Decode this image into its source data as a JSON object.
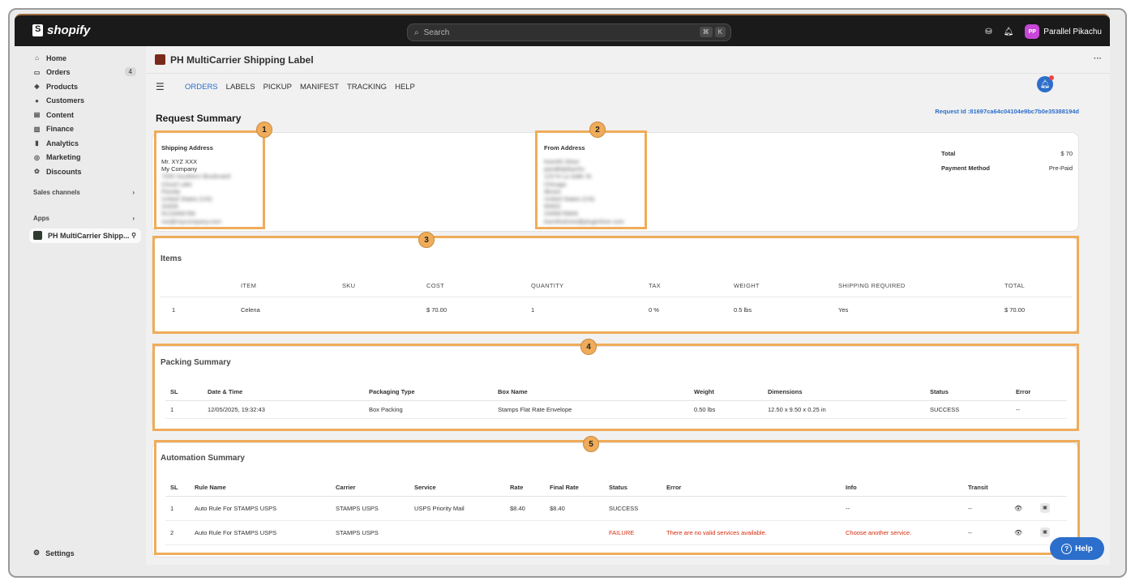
{
  "topbar": {
    "brand": "shopify",
    "search_placeholder": "Search",
    "shortcut_keys": [
      "⌘",
      "K"
    ],
    "user_initials": "PP",
    "user_name": "Parallel Pikachu"
  },
  "sidebar": {
    "items": [
      {
        "label": "Home",
        "icon": "home-icon"
      },
      {
        "label": "Orders",
        "icon": "orders-icon",
        "badge": "4"
      },
      {
        "label": "Products",
        "icon": "tag-icon"
      },
      {
        "label": "Customers",
        "icon": "person-icon"
      },
      {
        "label": "Content",
        "icon": "content-icon"
      },
      {
        "label": "Finance",
        "icon": "bank-icon"
      },
      {
        "label": "Analytics",
        "icon": "bar-chart-icon"
      },
      {
        "label": "Marketing",
        "icon": "target-icon"
      },
      {
        "label": "Discounts",
        "icon": "discount-icon"
      }
    ],
    "sales_channels": "Sales channels",
    "apps": "Apps",
    "app_item": "PH MultiCarrier Shipp...",
    "settings": "Settings"
  },
  "app": {
    "title": "PH MultiCarrier Shipping Label",
    "tabs": [
      "ORDERS",
      "LABELS",
      "PICKUP",
      "MANIFEST",
      "TRACKING",
      "HELP"
    ],
    "page_title": "Request Summary",
    "request_id": "Request Id :81697ca64c04104e9bc7b0e35388194d"
  },
  "shipping_address": {
    "title": "Shipping Address",
    "lines": [
      "Mr. XYZ XXX",
      "My Company",
      "7000 Southern Boulevard",
      "Cloud Lake",
      "Florida",
      "United States (US)",
      "33406",
      "9123456789",
      "me@mycompany.com"
    ]
  },
  "from_address": {
    "title": "From Address",
    "lines": [
      "Keerthi Shee",
      "parallelpikachu",
      "123 N La Salle St",
      "Chicago",
      "Illinois",
      "United States (US)",
      "60602",
      "2345678909",
      "keerthishree@pluginhive.com"
    ]
  },
  "summary": {
    "total_label": "Total",
    "total_value": "$ 70",
    "payment_label": "Payment Method",
    "payment_value": "Pre-Paid"
  },
  "items": {
    "title": "Items",
    "headers": [
      "",
      "ITEM",
      "SKU",
      "COST",
      "QUANTITY",
      "TAX",
      "WEIGHT",
      "SHIPPING REQUIRED",
      "TOTAL"
    ],
    "rows": [
      [
        "1",
        "Celena",
        "",
        "$ 70.00",
        "1",
        "0 %",
        "0.5 lbs",
        "Yes",
        "$ 70.00"
      ]
    ]
  },
  "packing": {
    "title": "Packing Summary",
    "headers": [
      "SL",
      "Date & Time",
      "Packaging Type",
      "Box Name",
      "Weight",
      "Dimensions",
      "Status",
      "Error"
    ],
    "rows": [
      [
        "1",
        "12/05/2025, 19:32:43",
        "Box Packing",
        "Stamps Flat Rate Envelope",
        "0.50 lbs",
        "12.50 x 9.50 x 0.25 in",
        "SUCCESS",
        "--"
      ]
    ]
  },
  "automation": {
    "title": "Automation Summary",
    "headers": [
      "SL",
      "Rule Name",
      "Carrier",
      "Service",
      "Rate",
      "Final Rate",
      "Status",
      "Error",
      "Info",
      "Transit",
      "",
      ""
    ],
    "rows": [
      [
        "1",
        "Auto Rule For STAMPS USPS",
        "STAMPS USPS",
        "USPS Priority Mail",
        "$8.40",
        "$8.40",
        "SUCCESS",
        "",
        "--",
        "--"
      ],
      [
        "2",
        "Auto Rule For STAMPS USPS",
        "STAMPS USPS",
        "",
        "",
        "",
        "FAILURE",
        "There are no valid services available.",
        "Choose another service.",
        "--"
      ]
    ]
  },
  "callouts": [
    "1",
    "2",
    "3",
    "4",
    "5"
  ],
  "help_label": "Help",
  "colors": {
    "accent": "#2c6ecb",
    "highlight": "#efac5a",
    "error": "#d72c0d"
  }
}
